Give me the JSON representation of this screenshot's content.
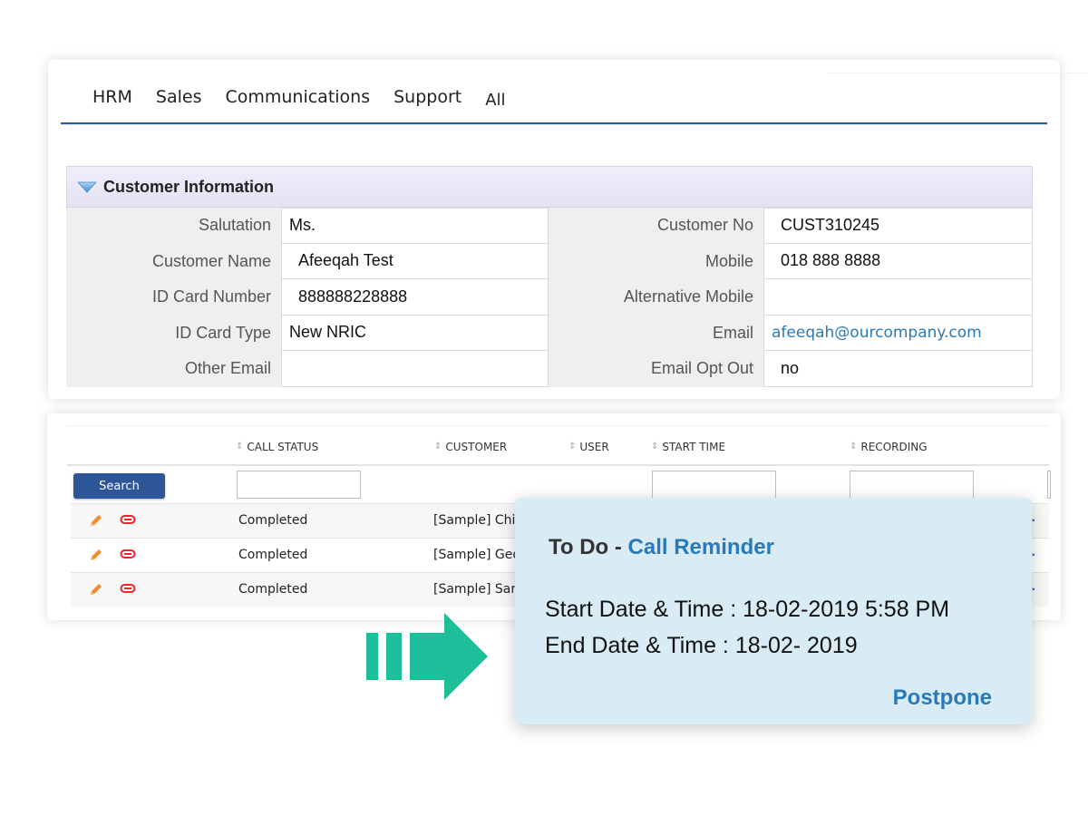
{
  "nav": {
    "items": [
      {
        "label": "HRM"
      },
      {
        "label": "Sales"
      },
      {
        "label": "Communications"
      },
      {
        "label": "Support"
      },
      {
        "label": "All"
      }
    ]
  },
  "customer_info": {
    "title": "Customer Information",
    "left_fields": [
      {
        "label": "Salutation",
        "value": "Ms."
      },
      {
        "label": "Customer Name",
        "value": "Afeeqah Test"
      },
      {
        "label": "ID Card Number",
        "value": "888888228888"
      },
      {
        "label": "ID Card Type",
        "value": "New NRIC"
      },
      {
        "label": "Other Email",
        "value": ""
      }
    ],
    "right_fields": [
      {
        "label": "Customer No",
        "value": "CUST310245"
      },
      {
        "label": "Mobile",
        "value": "018 888 8888"
      },
      {
        "label": "Alternative Mobile",
        "value": ""
      },
      {
        "label": "Email",
        "value": "afeeqah@ourcompany.com"
      },
      {
        "label": "Email Opt Out",
        "value": "no"
      }
    ]
  },
  "calls_table": {
    "columns": [
      {
        "label": "CALL STATUS"
      },
      {
        "label": "CUSTOMER"
      },
      {
        "label": "USER"
      },
      {
        "label": "START TIME"
      },
      {
        "label": "RECORDING"
      }
    ],
    "search_label": "Search",
    "rows": [
      {
        "status": "Completed",
        "customer": "[Sample] Chin",
        "more": "..."
      },
      {
        "status": "Completed",
        "customer": "[Sample] Geo",
        "more": ".."
      },
      {
        "status": "Completed",
        "customer": "[Sample] Sar",
        "more": "..."
      }
    ]
  },
  "popup": {
    "title_prefix": "To Do - ",
    "title_accent": "Call Reminder",
    "start_line": "Start Date & Time : 18-02-2019 5:58 PM",
    "end_line": "End Date & Time : 18-02- 2019",
    "postpone_label": "Postpone"
  },
  "colors": {
    "brand_blue": "#2d5aa0",
    "accent_blue": "#2a7ab8",
    "arrow_teal": "#1dbf9b",
    "edit_orange": "#f28c28",
    "link_red": "#e8262d",
    "popup_bg": "#d9ebf5"
  }
}
